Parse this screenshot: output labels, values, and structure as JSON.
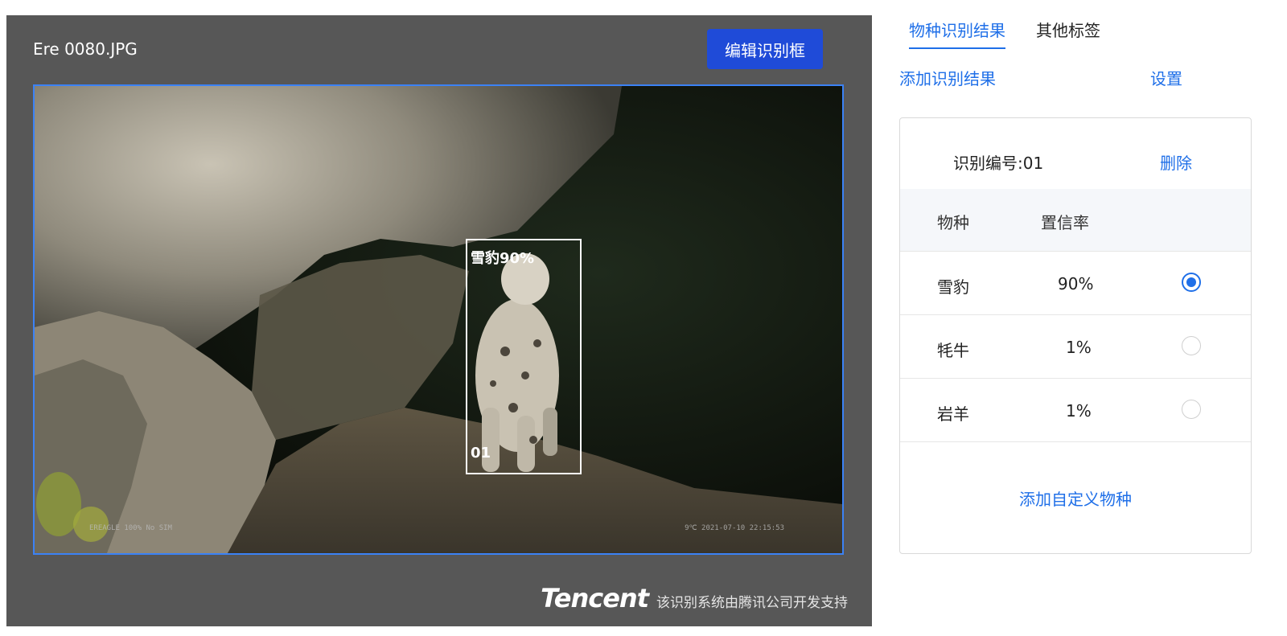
{
  "viewer": {
    "filename": "Ere 0080.JPG",
    "edit_button_label": "编辑识别框",
    "detection": {
      "label": "雪豹90%",
      "id": "01"
    },
    "camera_stamp_left": "EREAGLE   100%  No SIM",
    "camera_stamp_right": "9℃ 2021-07-10 22:15:53",
    "brand_logo": "Tencent",
    "brand_note": "该识别系统由腾讯公司开发支持"
  },
  "tabs": [
    {
      "label": "物种识别结果",
      "active": true
    },
    {
      "label": "其他标签",
      "active": false
    }
  ],
  "actions": {
    "add_result": "添加识别结果",
    "settings": "设置"
  },
  "result_card": {
    "record_id": "识别编号:01",
    "delete_label": "删除",
    "columns": [
      "物种",
      "置信率"
    ],
    "rows": [
      {
        "species": "雪豹",
        "confidence": "90%",
        "selected": true
      },
      {
        "species": "牦牛",
        "confidence": "1%",
        "selected": false
      },
      {
        "species": "岩羊",
        "confidence": "1%",
        "selected": false
      }
    ],
    "add_custom_label": "添加自定义物种"
  },
  "colors": {
    "accent": "#1f6fe8",
    "button": "#1f4bd8",
    "panel_bg": "#575757",
    "frame": "#3b82f6"
  }
}
